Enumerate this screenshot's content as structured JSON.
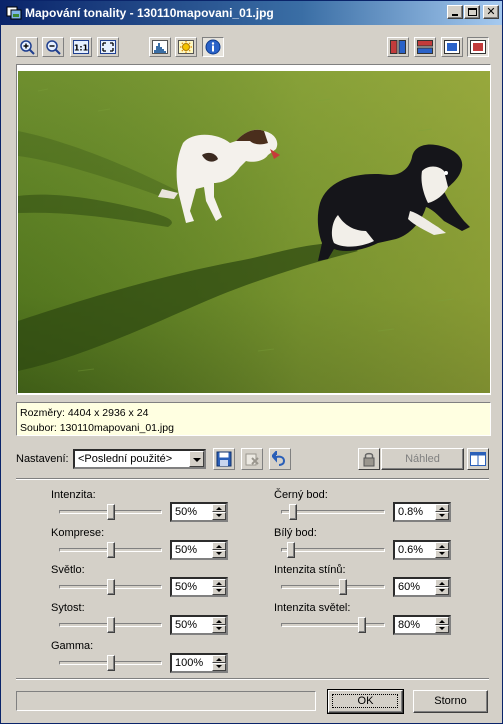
{
  "window": {
    "title": "Mapování tonality - 130110mapovani_01.jpg",
    "caption_buttons": [
      "minimize-icon",
      "maximize-icon",
      "close-icon"
    ]
  },
  "toolbar": {
    "left_buttons": [
      "zoom-in-icon",
      "zoom-out-icon",
      "actual-size-icon",
      "fit-window-icon"
    ],
    "middle_buttons": [
      "histogram-icon",
      "highlight-icon",
      "info-icon"
    ],
    "right_buttons": [
      "split-vertical-icon",
      "split-horizontal-icon",
      "single-view-icon",
      "clipping-warning-icon"
    ],
    "actual_size_label": "1:1"
  },
  "info": {
    "dimensions": "Rozměry: 4404 x 2936 x 24",
    "file": "Soubor: 130110mapovani_01.jpg"
  },
  "preset": {
    "label": "Nastavení:",
    "value": "<Poslední použité>",
    "preview_label": "Náhled"
  },
  "controls_left": [
    {
      "label": "Intenzita:",
      "value": "50%",
      "level": 0.5
    },
    {
      "label": "Komprese:",
      "value": "50%",
      "level": 0.5
    },
    {
      "label": "Světlo:",
      "value": "50%",
      "level": 0.5
    },
    {
      "label": "Sytost:",
      "value": "50%",
      "level": 0.5
    },
    {
      "label": "Gamma:",
      "value": "100%",
      "level": 0.5
    }
  ],
  "controls_right": [
    {
      "label": "Černý bod:",
      "value": "0.8%",
      "level": 0.08
    },
    {
      "label": "Bílý bod:",
      "value": "0.6%",
      "level": 0.06
    },
    {
      "label": "Intenzita stínů:",
      "value": "60%",
      "level": 0.6
    },
    {
      "label": "Intenzita světel:",
      "value": "80%",
      "level": 0.8
    }
  ],
  "footer": {
    "ok_label": "OK",
    "cancel_label": "Storno"
  },
  "colors": {
    "title_active": "#0a246a",
    "face": "#d4d0c8",
    "info_background": "#ffffe1"
  }
}
